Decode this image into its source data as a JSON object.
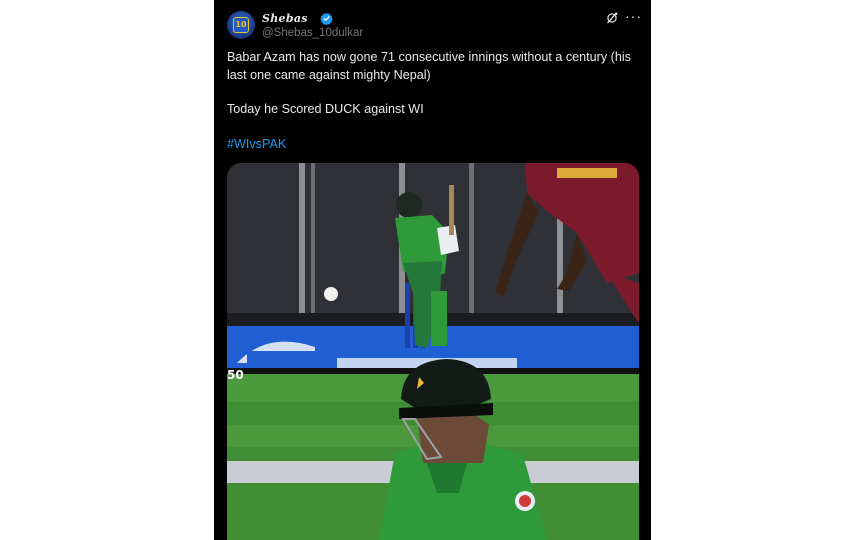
{
  "post": {
    "author": {
      "display_name": "Shebas",
      "handle": "@Shebas_10dulkar",
      "verified": true,
      "avatar_jersey_number": "10"
    },
    "body_line_1": "Babar Azam has now gone 71 consecutive innings without a century (his last one came against mighty Nepal)",
    "body_line_2": "Today he Scored DUCK against WI",
    "hashtag": "#WIvsPAK",
    "icons": {
      "grok": "grok-icon",
      "more": "more-options-icon",
      "verified": "verified-badge-icon"
    },
    "media": {
      "top_frame_overlay": "50",
      "colors": {
        "pakistan_jersey": "#2e9a3a",
        "westindies_jersey": "#7a1a2a",
        "turf": "#3f8d34",
        "advertising_board": "#1f5fd1"
      }
    }
  }
}
